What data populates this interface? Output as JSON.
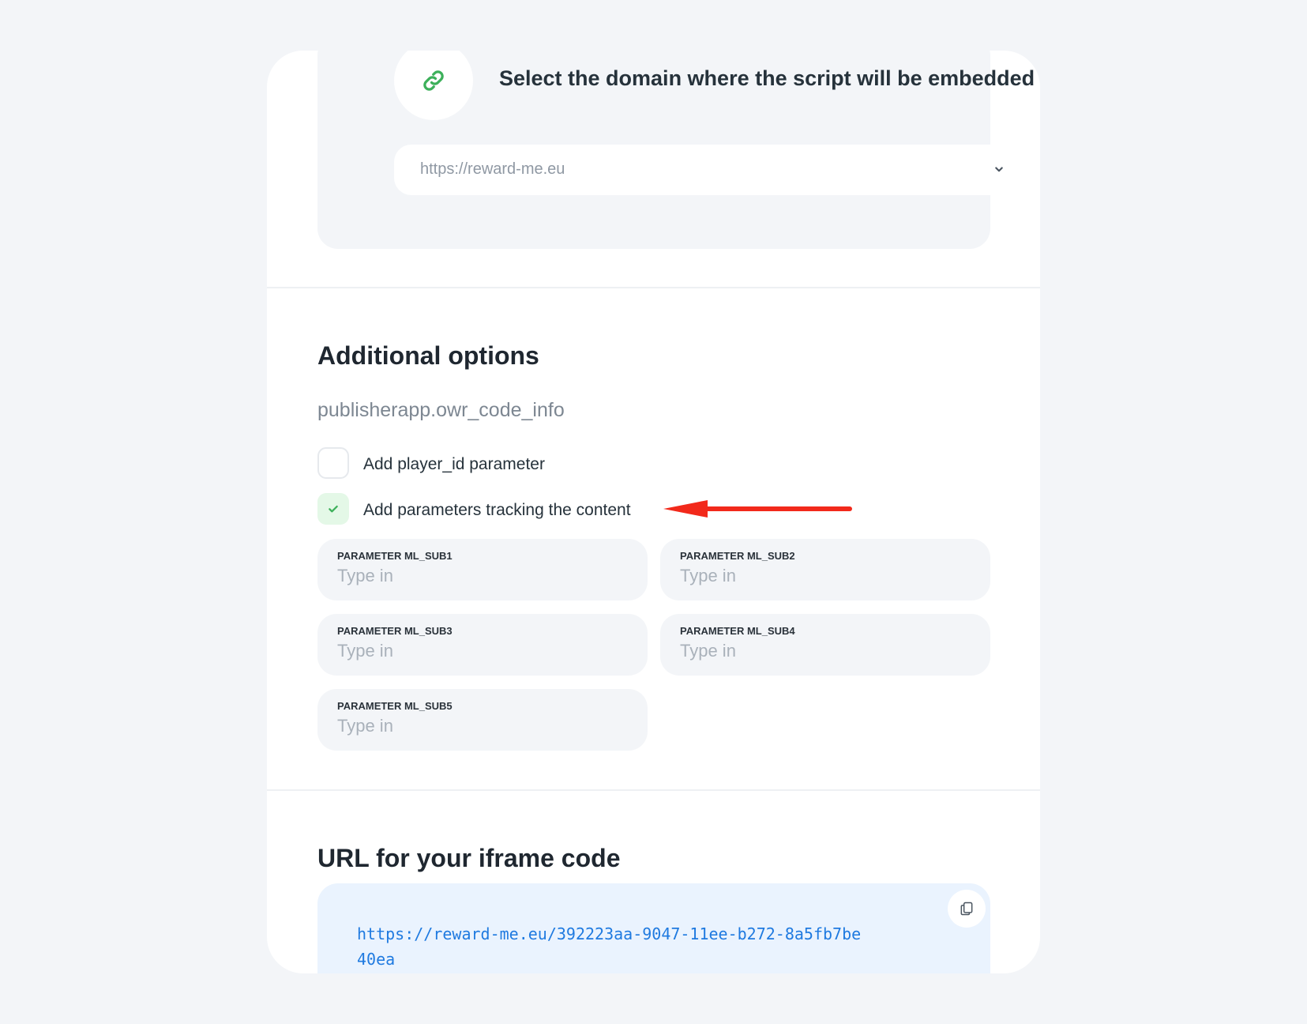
{
  "domain_section": {
    "title": "Select the domain where the script will be embedded",
    "selected_domain": "https://reward-me.eu",
    "icon": "link-icon"
  },
  "additional_options": {
    "title": "Additional options",
    "info": "publisherapp.owr_code_info",
    "checkboxes": [
      {
        "label": "Add player_id parameter",
        "checked": false
      },
      {
        "label": "Add parameters tracking the content",
        "checked": true
      }
    ],
    "parameters": [
      {
        "label": "PARAMETER ML_SUB1",
        "placeholder": "Type in"
      },
      {
        "label": "PARAMETER ML_SUB2",
        "placeholder": "Type in"
      },
      {
        "label": "PARAMETER ML_SUB3",
        "placeholder": "Type in"
      },
      {
        "label": "PARAMETER ML_SUB4",
        "placeholder": "Type in"
      },
      {
        "label": "PARAMETER ML_SUB5",
        "placeholder": "Type in"
      }
    ]
  },
  "iframe_section": {
    "title": "URL for your iframe code",
    "url": "https://reward-me.eu/392223aa-9047-11ee-b272-8a5fb7be40ea",
    "copy_icon": "copy-icon"
  },
  "colors": {
    "accent_green": "#3cb05a",
    "annotation_red": "#f2291b",
    "code_blue": "#1f7ae0"
  }
}
